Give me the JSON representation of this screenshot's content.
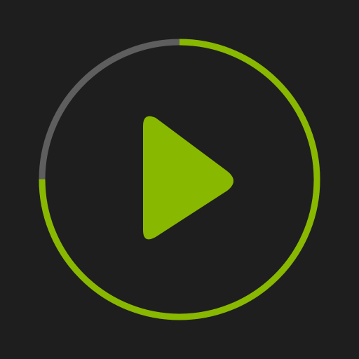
{
  "player": {
    "progress": 0.75,
    "play_icon": "play-icon",
    "colors": {
      "background": "#1e1e1e",
      "progress": "#88b800",
      "track": "#5e5e5e",
      "play": "#88b800"
    }
  }
}
